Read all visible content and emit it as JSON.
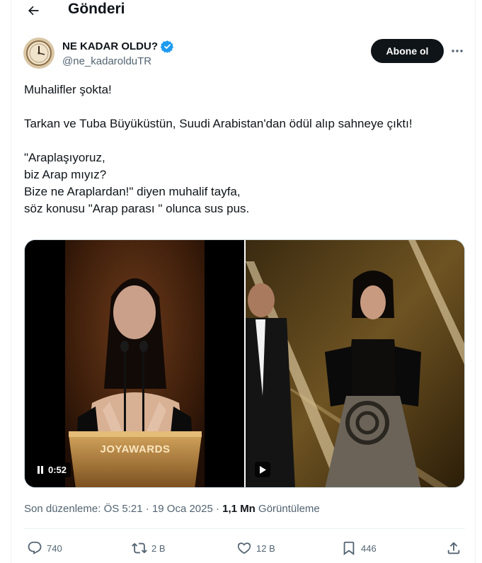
{
  "header": {
    "title": "Gönderi",
    "back_icon": "arrow-left-icon"
  },
  "author": {
    "display_name": "NE KADAR OLDU?",
    "handle": "@ne_kadarolduTR",
    "verified_icon": "verified-badge-icon",
    "verified_color": "#1d9bf0"
  },
  "follow_button": {
    "label": "Abone ol"
  },
  "tweet": {
    "line1": "Muhalifler şokta!",
    "line2": "Tarkan ve Tuba Büyüküstün, Suudi Arabistan'dan ödül alıp sahneye çıktı!",
    "line3": "\"Araplaşıyoruz,",
    "line4": "biz Arap mıyız?",
    "line5": "Bize ne Araplardan!\" diyen muhalif tayfa,",
    "line6": "söz konusu \"Arap parası \" olunca sus pus."
  },
  "media": {
    "video1": {
      "duration": "0:52",
      "state_icon": "pause-icon",
      "sign_text": "JOYAWARDS"
    },
    "video2": {
      "state_icon": "play-icon"
    }
  },
  "meta": {
    "edited": "Son düzenleme: ÖS 5:21 · 19 Oca 2025 ·",
    "views_count": "1,1 Mn",
    "views_label": "Görüntüleme"
  },
  "actions": {
    "replies": "740",
    "reposts": "2 B",
    "likes": "12 B",
    "bookmarks": "446"
  },
  "colors": {
    "text": "#0f1419",
    "secondary": "#536471",
    "border": "#eff3f4"
  }
}
